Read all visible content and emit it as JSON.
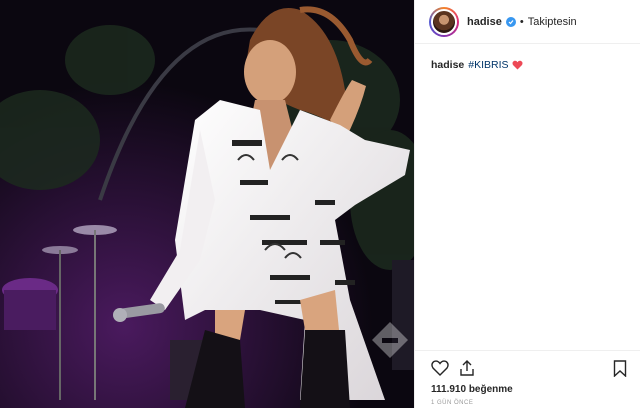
{
  "post": {
    "username": "hadise",
    "follow_status": "Takiptesin",
    "separator": "•",
    "caption_user": "hadise",
    "caption_hashtag": "#KIBRIS",
    "likes": "111.910 beğenme",
    "time_ago": "1 GÜN ÖNCE"
  },
  "icons": {
    "verified": "verified-badge-icon",
    "heart_emoji": "red-heart-icon",
    "like": "heart-outline-icon",
    "share": "share-icon",
    "save": "bookmark-icon"
  },
  "colors": {
    "verified": "#3897f0",
    "hashtag": "#003569",
    "heart_emoji": "#ed4956",
    "text": "#262626",
    "muted": "#999999"
  }
}
